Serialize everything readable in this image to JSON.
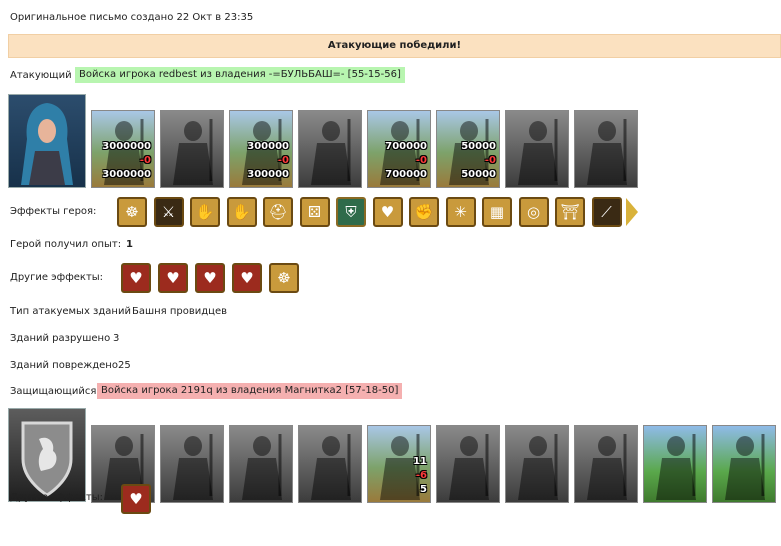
{
  "header": {
    "created": "Оригинальное письмо создано 22 Окт в 23:35"
  },
  "banner": {
    "result": "Атакующие победили!"
  },
  "attacker": {
    "label": "Атакующий",
    "owner": "Войска игрока redbest из владения -=БУЛЬБАШ=- [55-15-56]",
    "portrait_icon": "hooded-archer-hero",
    "units": [
      {
        "icon": "gold-golem-unit",
        "color": true,
        "count": "3000000",
        "lost": "-0",
        "remain": "3000000"
      },
      {
        "icon": "halberdier-unit",
        "color": false
      },
      {
        "icon": "paladin-rider-unit",
        "color": true,
        "count": "300000",
        "lost": "-0",
        "remain": "300000"
      },
      {
        "icon": "griffin-unit",
        "color": false
      },
      {
        "icon": "crossbowman-unit",
        "color": true,
        "count": "700000",
        "lost": "-0",
        "remain": "700000"
      },
      {
        "icon": "priest-unit",
        "color": true,
        "count": "50000",
        "lost": "-0",
        "remain": "50000"
      },
      {
        "icon": "dark-knight-unit",
        "color": false
      },
      {
        "icon": "angel-unit",
        "color": false
      }
    ],
    "hero_effects_label": "Эффекты героя:",
    "hero_effects": [
      "scroll",
      "sword",
      "handshake",
      "hand",
      "helmet",
      "dice",
      "shield",
      "heart-hand",
      "fist",
      "web",
      "barrel",
      "ring",
      "gate",
      "claw"
    ],
    "exp_label": "Герой получил опыт:",
    "exp_value": "1",
    "other_label": "Другие эффекты:",
    "other_effects": [
      "heart-sword",
      "heart-sword",
      "heart-sword",
      "heart-sword",
      "scroll"
    ]
  },
  "buildings": {
    "type_label": "Тип атакуемых зданий",
    "type_value": "Башня провидцев",
    "destroyed_label": "Зданий разрушено",
    "destroyed_value": "3",
    "damaged_label": "Зданий повреждено",
    "damaged_value": "25"
  },
  "defender": {
    "label": "Защищающийся",
    "owner": "Войска игрока 2191q из владения Магнитка2 [57-18-50]",
    "portrait_icon": "lion-crest-shield",
    "units": [
      {
        "icon": "golem-unit",
        "color": false
      },
      {
        "icon": "halberdier-unit",
        "color": false
      },
      {
        "icon": "paladin-rider-unit",
        "color": false
      },
      {
        "icon": "griffin-unit",
        "color": false
      },
      {
        "icon": "crossbowman-unit",
        "color": true,
        "count": "11",
        "lost": "-6",
        "remain": "5"
      },
      {
        "icon": "priest-unit",
        "color": false
      },
      {
        "icon": "dark-knight-unit",
        "color": false
      },
      {
        "icon": "angel-unit",
        "color": false
      },
      {
        "icon": "mage-tower-unit",
        "color": "castle"
      },
      {
        "icon": "mage-tower-unit",
        "color": "castle"
      }
    ],
    "other_label": "Другие эффекты:",
    "other_effects": [
      "heart-sword"
    ]
  },
  "colors": {
    "banner": "#fbe1c0",
    "attacker_owner_bg": "#b8f5b0",
    "defender_owner_bg": "#f5b0b0",
    "lost": "#ff3a3a"
  }
}
